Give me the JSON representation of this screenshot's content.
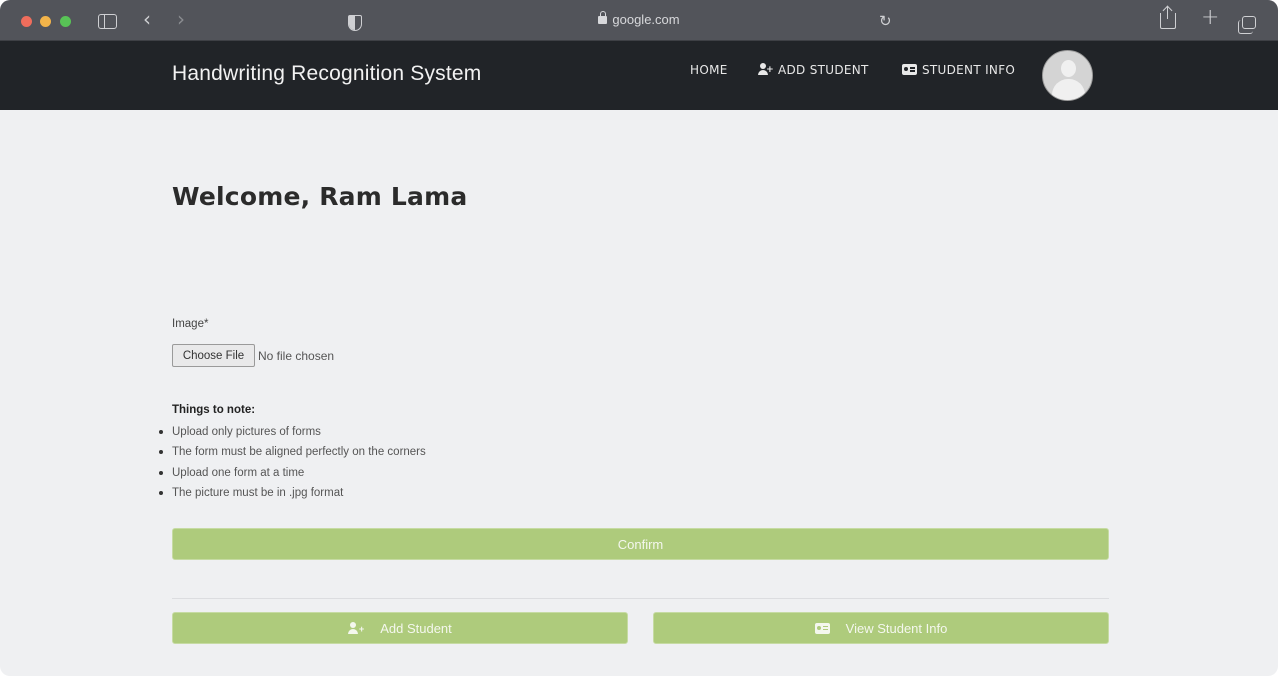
{
  "browser": {
    "url": "google.com"
  },
  "navbar": {
    "brand": "Handwriting Recognition System",
    "links": [
      {
        "label": "HOME"
      },
      {
        "label": "ADD STUDENT"
      },
      {
        "label": "STUDENT INFO"
      }
    ]
  },
  "main": {
    "welcome": "Welcome, Ram Lama",
    "image_field": {
      "label": "Image*",
      "button_label": "Choose File",
      "status": "No file chosen"
    },
    "notes": {
      "title": "Things to note:",
      "items": [
        "Upload only pictures of forms",
        "The form must be aligned perfectly on the corners",
        "Upload one form at a time",
        "The picture must be in .jpg format"
      ]
    },
    "confirm_label": "Confirm",
    "add_student_label": "Add Student",
    "view_student_label": "View Student Info"
  },
  "colors": {
    "navbar_bg": "#212428",
    "page_bg": "#eff0f2",
    "button_green": "#aecb7c"
  },
  "icons": [
    "sidebar-icon",
    "back-icon",
    "forward-icon",
    "shield-icon",
    "lock-icon",
    "reload-icon",
    "share-icon",
    "new-tab-icon",
    "tabs-icon",
    "add-user-icon",
    "id-card-icon",
    "avatar"
  ]
}
